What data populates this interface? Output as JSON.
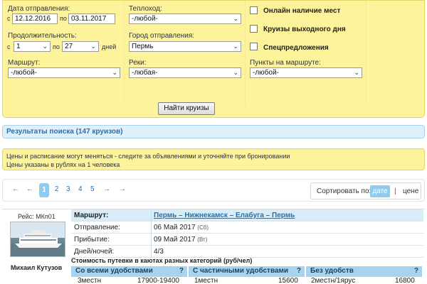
{
  "form": {
    "depart_label": "Дата отправления:",
    "from_label": "с",
    "date_from": "12.12.2016",
    "to_label": "по",
    "date_to": "03.11.2017",
    "ship_label": "Теплоход:",
    "ship_value": "-любой-",
    "duration_label": "Продолжительность:",
    "dur_from_label": "с",
    "dur_from": "1",
    "dur_to_label": "по",
    "dur_to": "27",
    "days_label": "дней",
    "city_label": "Город отправления:",
    "city_value": "Пермь",
    "route_label": "Маршрут:",
    "route_value": "-любой-",
    "rivers_label": "Реки:",
    "rivers_value": "-любая-",
    "points_label": "Пункты на маршруте:",
    "points_value": "-любой-",
    "cb_online": "Онлайн наличие мест",
    "cb_weekend": "Круизы выходного дня",
    "cb_special": "Спецпредложения",
    "find_button": "Найти круизы"
  },
  "results_label": "Результаты поиска (147 круизов)",
  "notice": {
    "line1": "Цены и расписание могут меняться - следите за объявлениями и уточняйте при бронировании",
    "line2": "Цены указаны в рублях на 1 человека"
  },
  "pager": {
    "first": "←",
    "prev": "←",
    "pages": [
      "1",
      "2",
      "3",
      "4",
      "5"
    ],
    "next": "→",
    "last": "→",
    "sort_label": "Сортировать по:",
    "sort_date": "дате",
    "sort_sep": "|",
    "sort_price": "цене"
  },
  "cruise": {
    "flight": "Рейс: МКп01",
    "ship_name": "Михаил Кутузов",
    "route_label": "Маршрут:",
    "route_value": "Пермь – Нижнекамск – Елабуга – Пермь",
    "depart_label": "Отправление:",
    "depart_value": "06 Май 2017",
    "depart_day": "(Сб)",
    "arrive_label": "Прибытие:",
    "arrive_value": "09 Май 2017",
    "arrive_day": "(Вт)",
    "daysnights_label": "Дней/ночей:",
    "daysnights_value": "4/3",
    "cabins_title": "Стоимость путевки в каютах разных категорий (руб/чел)",
    "cabin_cols": [
      {
        "title": "Со всеми удобствами",
        "q": "?"
      },
      {
        "title": "С частичными удобствами",
        "q": "?"
      },
      {
        "title": "Без удобств",
        "q": "?"
      }
    ],
    "cabin_rows": [
      [
        "3местн",
        "17900-19400",
        "1местн",
        "15600",
        "2местн/1ярус",
        "16800"
      ]
    ]
  },
  "colors": {
    "form_bg": "#fdf39a",
    "link": "#2a6fae",
    "header_blue": "#a8d3ef",
    "active_blue": "#8ecbee"
  }
}
